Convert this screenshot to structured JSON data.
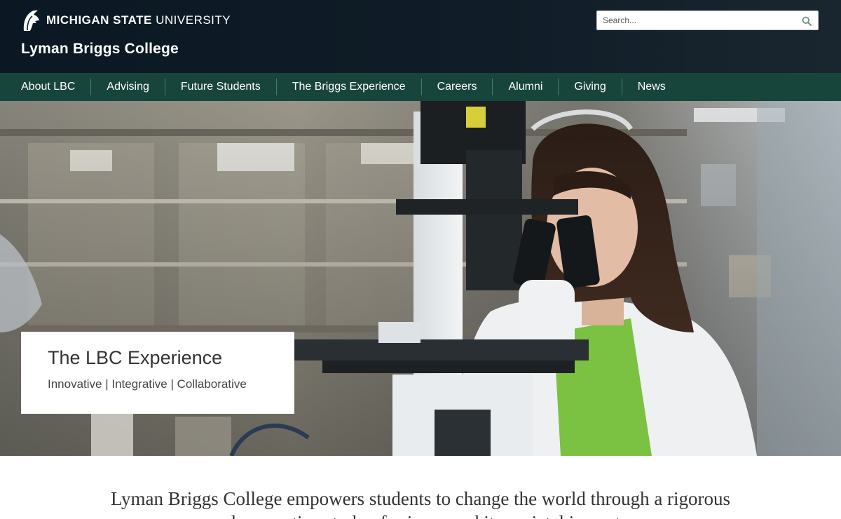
{
  "header": {
    "university_bold": "MICHIGAN STATE",
    "university_light": "UNIVERSITY",
    "college_title": "Lyman Briggs College",
    "search_placeholder": "Search...",
    "logo_icon": "spartan-helmet-icon",
    "search_icon": "search-icon"
  },
  "nav": {
    "items": [
      {
        "label": "About LBC"
      },
      {
        "label": "Advising"
      },
      {
        "label": "Future Students"
      },
      {
        "label": "The Briggs Experience"
      },
      {
        "label": "Careers"
      },
      {
        "label": "Alumni"
      },
      {
        "label": "Giving"
      },
      {
        "label": "News"
      }
    ]
  },
  "hero": {
    "title": "The LBC Experience",
    "subtitle": "Innovative | Integrative | Collaborative"
  },
  "intro": {
    "text": "Lyman Briggs College empowers students to change the world through a rigorous and supportive study of science and its societal impacts."
  },
  "colors": {
    "header_bg": "#101d28",
    "nav_bg": "#18453b",
    "accent_green": "#7bc142"
  }
}
